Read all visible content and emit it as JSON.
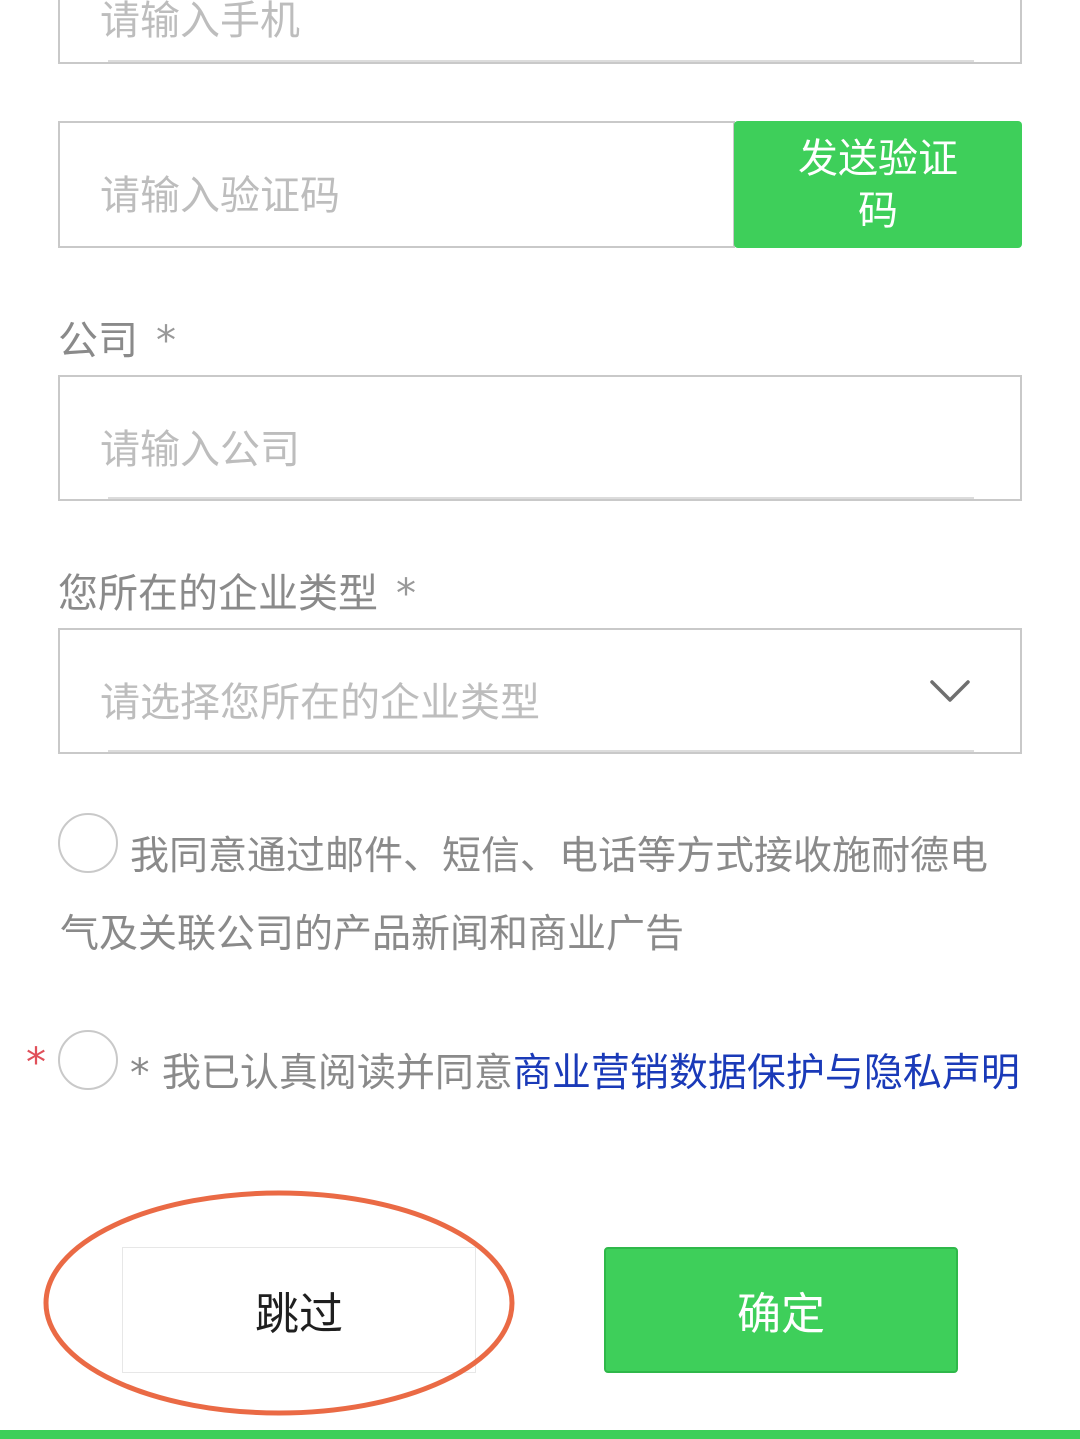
{
  "form": {
    "phone": {
      "placeholder": "请输入手机"
    },
    "verification": {
      "placeholder": "请输入验证码",
      "send_button_label": "发送验证码"
    },
    "company": {
      "label": "公司",
      "required_mark": "*",
      "placeholder": "请输入公司"
    },
    "enterprise_type": {
      "label": "您所在的企业类型",
      "required_mark": "*",
      "placeholder": "请选择您所在的企业类型",
      "dropdown_icon": "chevron-down-icon"
    },
    "marketing_consent": {
      "text": "我同意通过邮件、短信、电话等方式接收施耐德电气及关联公司的产品新闻和商业广告"
    },
    "privacy_consent": {
      "required_mark": "*",
      "prefix": "* 我已认真阅读并同意",
      "link_text": "商业营销数据保护与隐私声明"
    }
  },
  "actions": {
    "skip_label": "跳过",
    "confirm_label": "确定"
  },
  "colors": {
    "accent_green": "#3ecf5a",
    "link_blue": "#1a3ab8",
    "required_red": "#e0505a",
    "annotation_circle": "#ea6a45"
  }
}
